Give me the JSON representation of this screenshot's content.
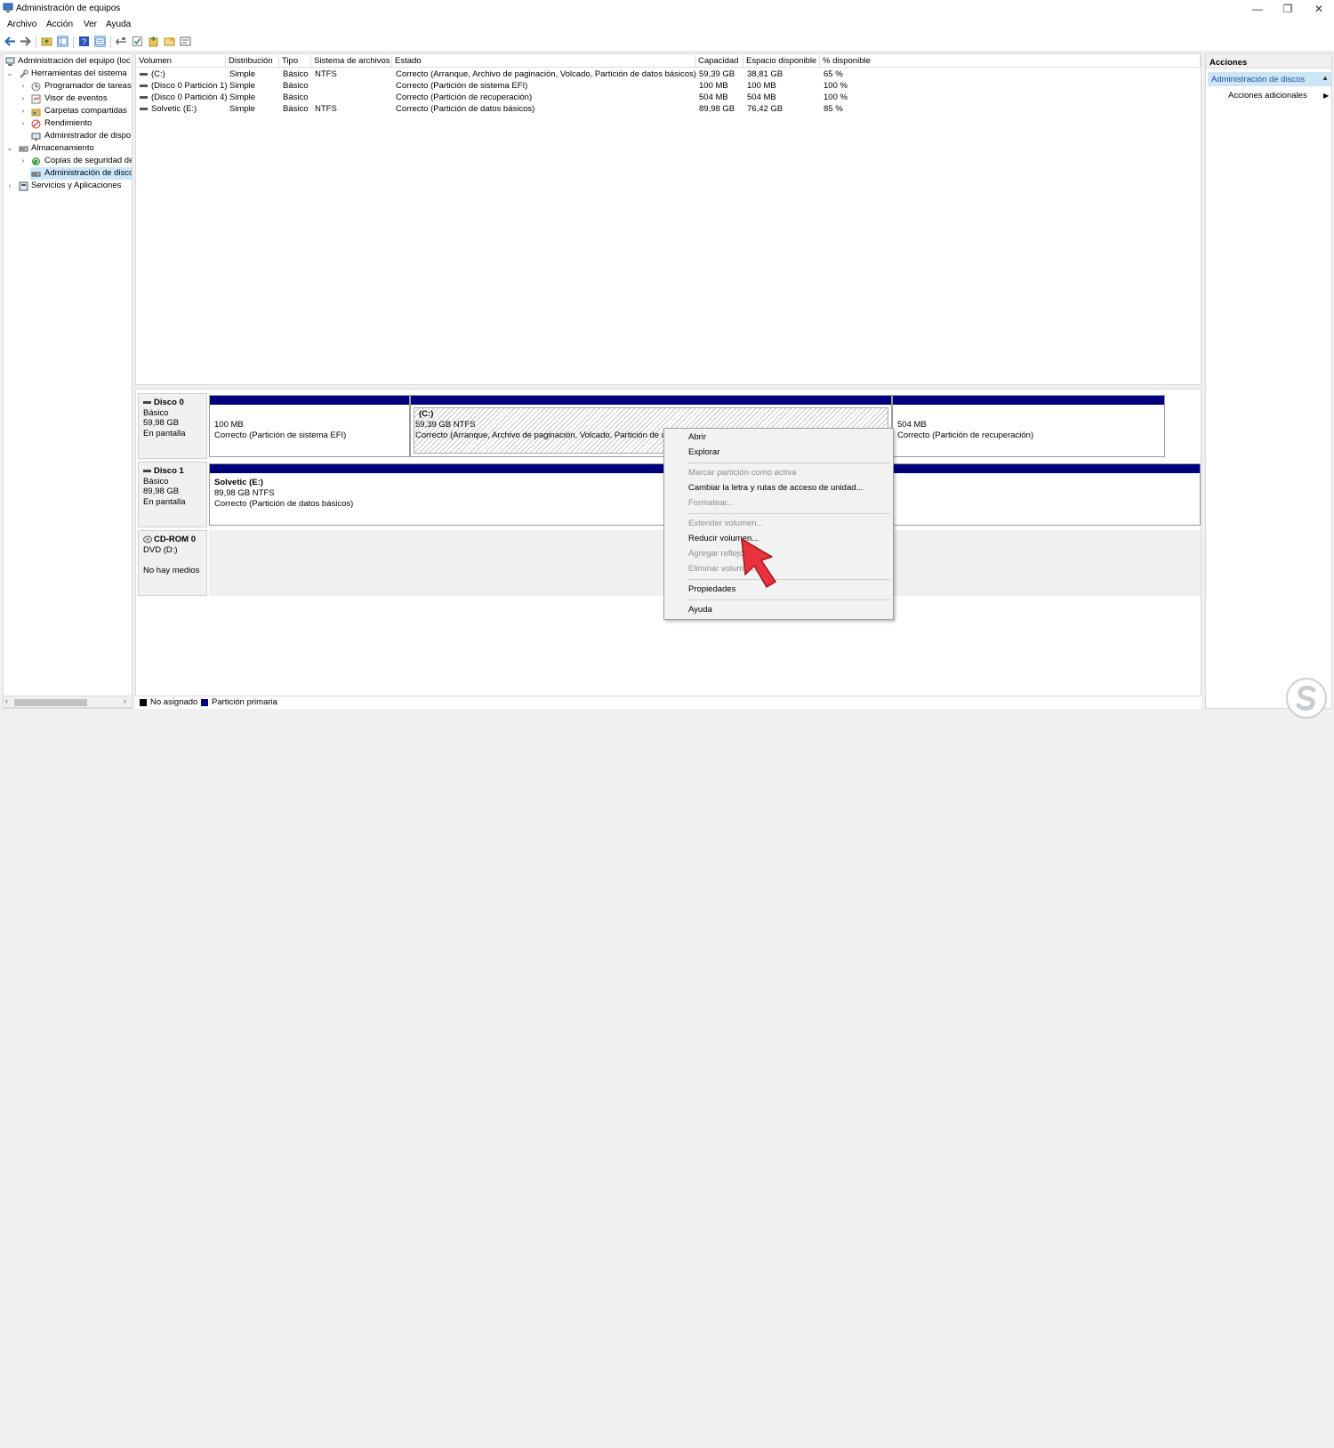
{
  "window": {
    "title": "Administración de equipos",
    "minimize": "—",
    "restore": "❐",
    "close": "✕"
  },
  "menu": [
    "Archivo",
    "Acción",
    "Ver",
    "Ayuda"
  ],
  "toolbar": {
    "icons": [
      "back-arrow-icon",
      "forward-arrow-icon",
      "folder-up-icon",
      "show-tree-icon",
      "help-icon",
      "properties-icon",
      "connect-icon",
      "check-icon",
      "new-icon",
      "folder-open-icon",
      "view-icon"
    ]
  },
  "tree": {
    "items": [
      {
        "label": "Administración del equipo (loc",
        "indent": 0,
        "chevron": ""
      },
      {
        "label": "Herramientas del sistema",
        "indent": 1,
        "chevron": "v"
      },
      {
        "label": "Programador de tareas",
        "indent": 2,
        "chevron": ">"
      },
      {
        "label": "Visor de eventos",
        "indent": 2,
        "chevron": ">"
      },
      {
        "label": "Carpetas compartidas",
        "indent": 2,
        "chevron": ">"
      },
      {
        "label": "Rendimiento",
        "indent": 2,
        "chevron": ">"
      },
      {
        "label": "Administrador de dispo",
        "indent": 2,
        "chevron": ""
      },
      {
        "label": "Almacenamiento",
        "indent": 1,
        "chevron": "v"
      },
      {
        "label": "Copias de seguridad de",
        "indent": 2,
        "chevron": ">"
      },
      {
        "label": "Administración de disco",
        "indent": 2,
        "chevron": "",
        "selected": true
      },
      {
        "label": "Servicios y Aplicaciones",
        "indent": 1,
        "chevron": ">"
      }
    ]
  },
  "volumes": {
    "headers": [
      "Volumen",
      "Distribución",
      "Tipo",
      "Sistema de archivos",
      "Estado",
      "Capacidad",
      "Espacio disponible",
      "% disponible"
    ],
    "rows": [
      [
        "(C:)",
        "Simple",
        "Básico",
        "NTFS",
        "Correcto (Arranque, Archivo de paginación, Volcado, Partición de datos básicos)",
        "59,39 GB",
        "38,81 GB",
        "65 %"
      ],
      [
        "(Disco 0 Partición 1)",
        "Simple",
        "Básico",
        "",
        "Correcto (Partición de sistema EFI)",
        "100 MB",
        "100 MB",
        "100 %"
      ],
      [
        "(Disco 0 Partición 4)",
        "Simple",
        "Básico",
        "",
        "Correcto (Partición de recuperación)",
        "504 MB",
        "504 MB",
        "100 %"
      ],
      [
        "Solvetic (E:)",
        "Simple",
        "Básico",
        "NTFS",
        "Correcto (Partición de datos básicos)",
        "89,98 GB",
        "76,42 GB",
        "85 %"
      ]
    ]
  },
  "disks": {
    "disk0": {
      "name": "Disco 0",
      "type": "Básico",
      "size": "59,98 GB",
      "status": "En pantalla",
      "p1": {
        "line1": "100 MB",
        "line2": "Correcto (Partición de sistema EFI)"
      },
      "p2": {
        "line0": "(C:)",
        "line1": "59,39 GB NTFS",
        "line2": "Correcto (Arranque, Archivo de paginación, Volcado, Partición de da"
      },
      "p3": {
        "line1": "504 MB",
        "line2": "Correcto (Partición de recuperación)"
      }
    },
    "disk1": {
      "name": "Disco 1",
      "type": "Básico",
      "size": "89,98 GB",
      "status": "En pantalla",
      "p1": {
        "line0": "Solvetic  (E:)",
        "line1": "89,98 GB NTFS",
        "line2": "Correcto (Partición de datos básicos)"
      }
    },
    "cdrom": {
      "name": "CD-ROM 0",
      "type": "DVD (D:)",
      "status": "No hay medios"
    }
  },
  "legend": [
    {
      "label": "No asignado",
      "color": "#000000"
    },
    {
      "label": "Partición primaria",
      "color": "#00007e"
    }
  ],
  "actions": {
    "header": "Acciones",
    "section": "Administración de discos",
    "more": "Acciones adicionales"
  },
  "context_menu": {
    "items": [
      {
        "label": "Abrir",
        "enabled": true
      },
      {
        "label": "Explorar",
        "enabled": true
      },
      {
        "label": "Marcar partición como activa",
        "enabled": false
      },
      {
        "label": "Cambiar la letra y rutas de acceso de unidad...",
        "enabled": true
      },
      {
        "label": "Formatear...",
        "enabled": false
      },
      {
        "label": "Extender volumen...",
        "enabled": false
      },
      {
        "label": "Reducir volumen...",
        "enabled": true
      },
      {
        "label": "Agregar reflejo...",
        "enabled": false
      },
      {
        "label": "Eliminar volumen...",
        "enabled": false
      },
      {
        "label": "Propiedades",
        "enabled": true
      },
      {
        "label": "Ayuda",
        "enabled": true
      }
    ]
  },
  "colors": {
    "primary_partition": "#00007e",
    "selection": "#cce8ff",
    "action_highlight": "#cde6f7",
    "pointer": "#e8323c"
  }
}
